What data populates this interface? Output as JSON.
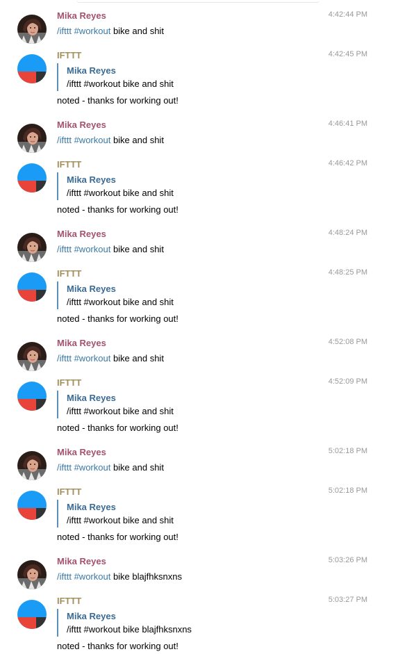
{
  "users": {
    "mika": {
      "name": "Mika Reyes",
      "color": "#a4526d"
    },
    "bot": {
      "name": "IFTTT",
      "color": "#a28f5b"
    }
  },
  "colors": {
    "command": "#3a79a8",
    "quote_bar": "#5b8fba",
    "bot_blue": "#1a9bf5",
    "bot_red": "#e8443a",
    "bot_dark": "#333333"
  },
  "messages": [
    {
      "type": "user",
      "time": "4:42:44 PM",
      "cmd": "/ifttt",
      "tag": "#workout",
      "text": " bike and shit"
    },
    {
      "type": "bot",
      "time": "4:42:45 PM",
      "quote_name": "Mika Reyes",
      "quote_text": "/ifttt #workout bike and shit",
      "reply": "noted - thanks for working out!"
    },
    {
      "type": "user",
      "time": "4:46:41 PM",
      "cmd": "/ifttt",
      "tag": "#workout",
      "text": " bike and shit"
    },
    {
      "type": "bot",
      "time": "4:46:42 PM",
      "quote_name": "Mika Reyes",
      "quote_text": "/ifttt #workout bike and shit",
      "reply": "noted - thanks for working out!"
    },
    {
      "type": "user",
      "time": "4:48:24 PM",
      "cmd": "/ifttt",
      "tag": "#workout",
      "text": " bike and shit"
    },
    {
      "type": "bot",
      "time": "4:48:25 PM",
      "quote_name": "Mika Reyes",
      "quote_text": "/ifttt #workout bike and shit",
      "reply": "noted - thanks for working out!"
    },
    {
      "type": "user",
      "time": "4:52:08 PM",
      "cmd": "/ifttt",
      "tag": "#workout",
      "text": " bike and shit"
    },
    {
      "type": "bot",
      "time": "4:52:09 PM",
      "quote_name": "Mika Reyes",
      "quote_text": "/ifttt #workout bike and shit",
      "reply": "noted - thanks for working out!"
    },
    {
      "type": "user",
      "time": "5:02:18 PM",
      "cmd": "/ifttt",
      "tag": "#workout",
      "text": " bike and shit"
    },
    {
      "type": "bot",
      "time": "5:02:18 PM",
      "quote_name": "Mika Reyes",
      "quote_text": "/ifttt #workout bike and shit",
      "reply": "noted - thanks for working out!"
    },
    {
      "type": "user",
      "time": "5:03:26 PM",
      "cmd": "/ifttt",
      "tag": "#workout",
      "text": " bike blajfhksnxns"
    },
    {
      "type": "bot",
      "time": "5:03:27 PM",
      "quote_name": "Mika Reyes",
      "quote_text": "/ifttt #workout bike blajfhksnxns",
      "reply": "noted - thanks for working out!"
    }
  ]
}
